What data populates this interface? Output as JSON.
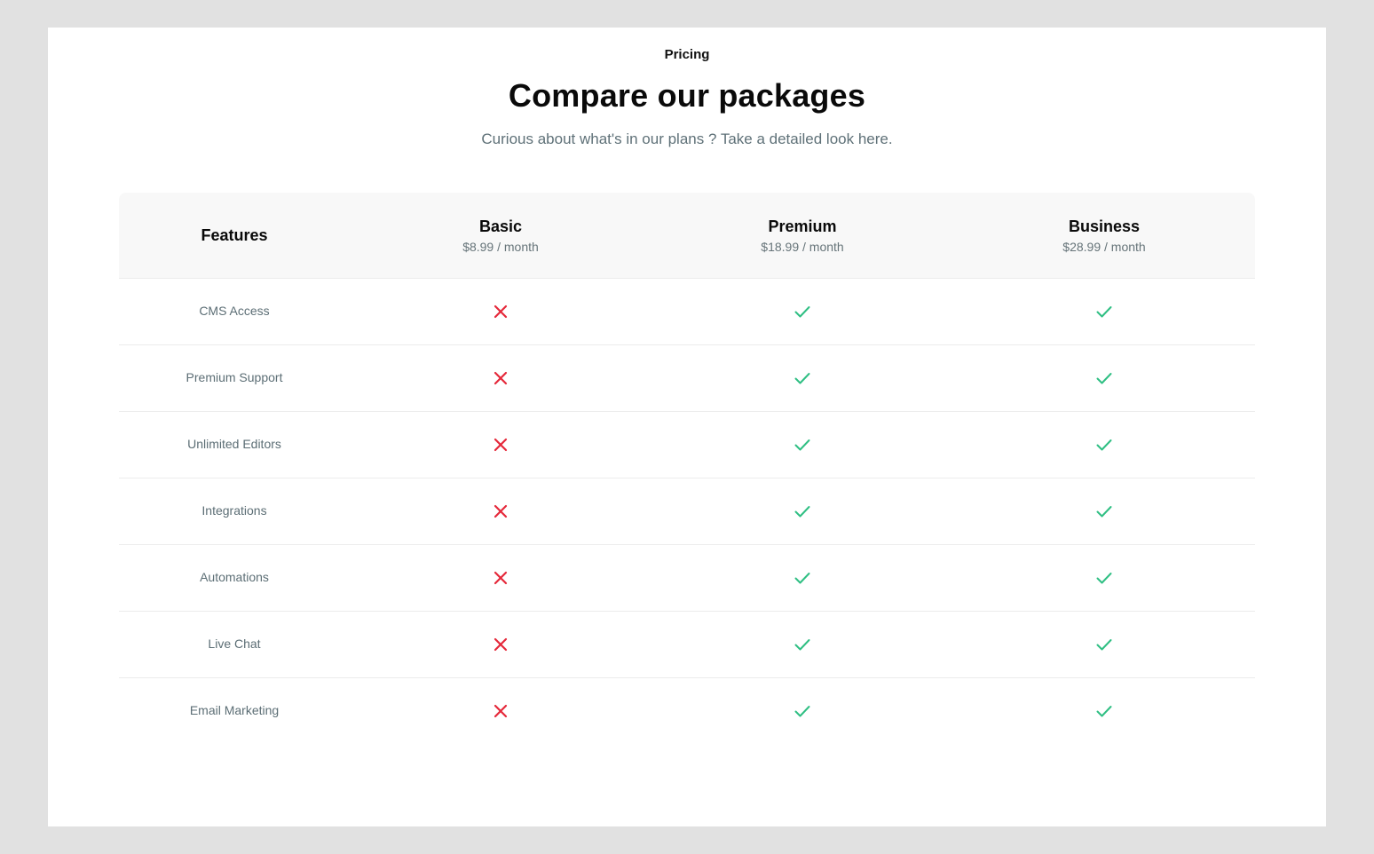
{
  "header": {
    "eyebrow": "Pricing",
    "title": "Compare our packages",
    "subtitle": "Curious about what's in our plans ? Take a detailed look here."
  },
  "table": {
    "features_header": "Features",
    "plans": [
      {
        "name": "Basic",
        "price": "$8.99 / month"
      },
      {
        "name": "Premium",
        "price": "$18.99 / month"
      },
      {
        "name": "Business",
        "price": "$28.99 / month"
      }
    ],
    "rows": [
      {
        "feature": "CMS Access",
        "included": [
          false,
          true,
          true
        ]
      },
      {
        "feature": "Premium Support",
        "included": [
          false,
          true,
          true
        ]
      },
      {
        "feature": "Unlimited Editors",
        "included": [
          false,
          true,
          true
        ]
      },
      {
        "feature": "Integrations",
        "included": [
          false,
          true,
          true
        ]
      },
      {
        "feature": "Automations",
        "included": [
          false,
          true,
          true
        ]
      },
      {
        "feature": "Live Chat",
        "included": [
          false,
          true,
          true
        ]
      },
      {
        "feature": "Email Marketing",
        "included": [
          false,
          true,
          true
        ]
      }
    ]
  },
  "colors": {
    "check": "#2fbf83",
    "cross": "#e5283a"
  },
  "icons": {
    "included": "check-icon",
    "excluded": "cross-icon"
  }
}
